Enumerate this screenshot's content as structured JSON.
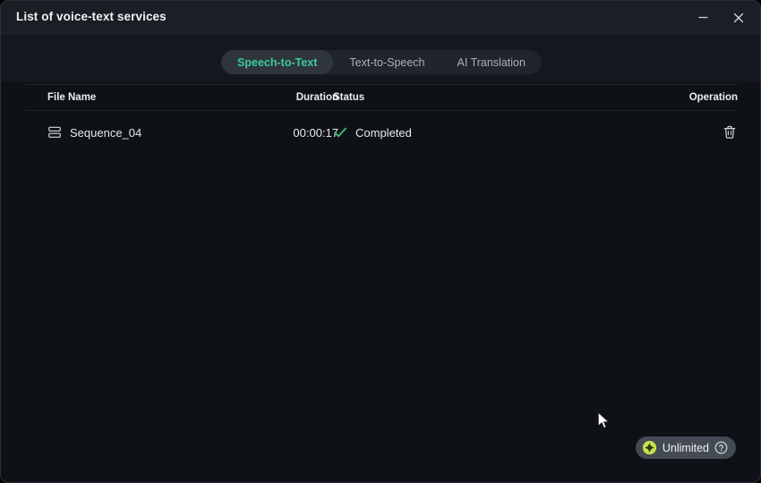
{
  "window": {
    "title": "List of voice-text services",
    "controls": {
      "minimize_name": "minimize-icon",
      "close_name": "close-icon"
    },
    "colors": {
      "window_bg": "#0e1116",
      "titlebar_bg": "#1a1e25",
      "tabbar_bg": "#14181e",
      "accent_green": "#3fc99a",
      "status_green": "#3cb878",
      "badge_bg": "#444b55",
      "badge_icon": "#c9e04a",
      "text_primary": "#e8eaee",
      "text_muted": "#a8afb8"
    }
  },
  "tabs": [
    {
      "label": "Speech-to-Text",
      "active": true
    },
    {
      "label": "Text-to-Speech",
      "active": false
    },
    {
      "label": "AI Translation",
      "active": false
    }
  ],
  "table": {
    "columns": {
      "file_name": "File Name",
      "duration": "Duration",
      "status": "Status",
      "operation": "Operation"
    },
    "rows": [
      {
        "file_name": "Sequence_04",
        "file_icon": "layers-icon",
        "duration": "00:00:17",
        "status": "Completed",
        "status_icon": "check-icon",
        "operation_icon": "trash-icon"
      }
    ]
  },
  "badge": {
    "label": "Unlimited",
    "icon": "star-burst-icon",
    "help_icon": "help-circle-icon"
  }
}
